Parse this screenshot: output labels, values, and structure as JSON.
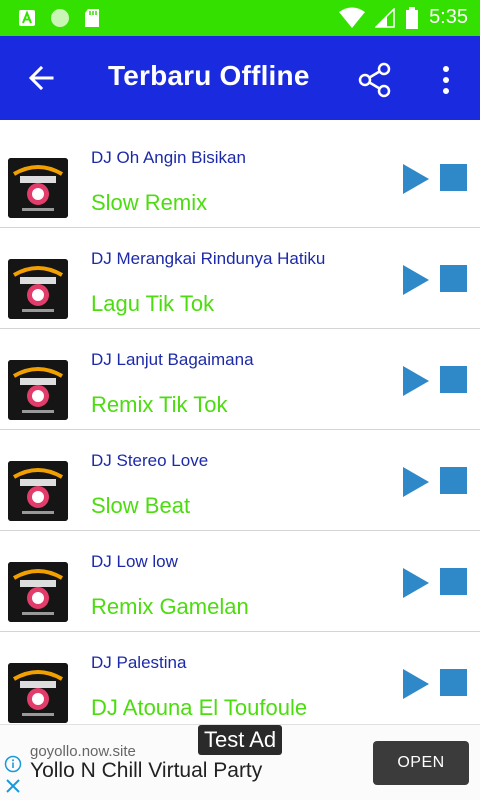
{
  "status_bar": {
    "time": "5:35"
  },
  "app_bar": {
    "title": "Terbaru Offline"
  },
  "songs": [
    {
      "title": "DJ Oh Angin Bisikan",
      "subtitle": "Slow Remix"
    },
    {
      "title": "DJ Merangkai Rindunya Hatiku",
      "subtitle": "Lagu Tik Tok"
    },
    {
      "title": "DJ Lanjut Bagaimana",
      "subtitle": "Remix Tik Tok"
    },
    {
      "title": "DJ Stereo Love",
      "subtitle": "Slow Beat"
    },
    {
      "title": "DJ Low low",
      "subtitle": "Remix Gamelan"
    },
    {
      "title": "DJ Palestina",
      "subtitle": "DJ Atouna El Toufoule"
    }
  ],
  "ad": {
    "label": "Test Ad",
    "domain": "goyollo.now.site",
    "headline": "Yollo N Chill Virtual Party",
    "button": "OPEN"
  },
  "colors": {
    "status_bar": "#34e000",
    "app_bar": "#1a2bdf",
    "title_text": "#1c2aa8",
    "subtitle_text": "#4cdc10",
    "control": "#2f89c8"
  }
}
